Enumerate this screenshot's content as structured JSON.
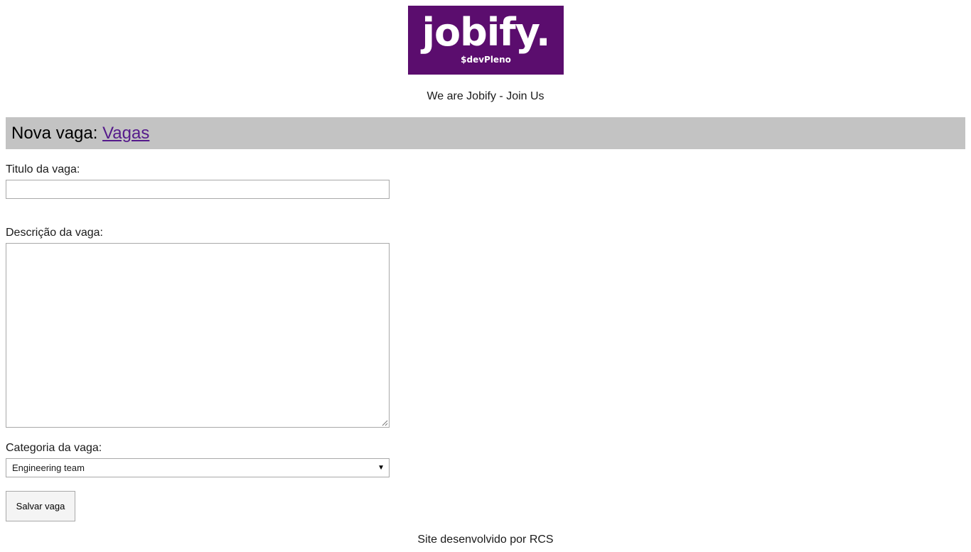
{
  "brand": {
    "logo_text": "jobify.",
    "logo_subtext": "$devPleno",
    "logo_bg_color": "#5b0d6e",
    "tagline": "We are Jobify - Join Us"
  },
  "header": {
    "title_prefix": "Nova vaga:",
    "link_label": "Vagas",
    "bar_color": "#c3c3c3",
    "link_color": "#551a8b"
  },
  "form": {
    "title_label": "Titulo da vaga:",
    "title_value": "",
    "description_label": "Descrição da vaga:",
    "description_value": "",
    "category_label": "Categoria da vaga:",
    "category_selected": "Engineering team",
    "submit_label": "Salvar vaga"
  },
  "footer": {
    "text": "Site desenvolvido por RCS"
  }
}
